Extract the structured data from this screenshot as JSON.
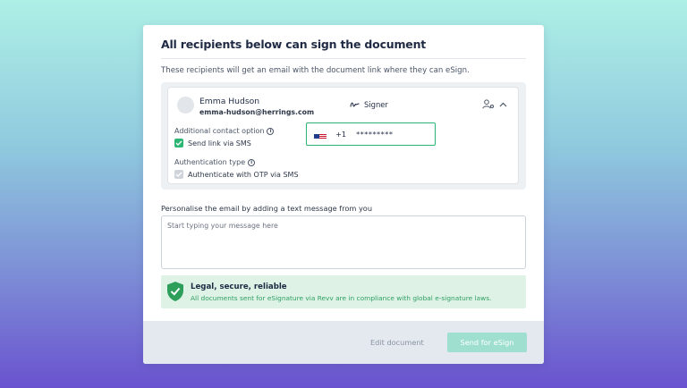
{
  "modal": {
    "title": "All recipients below can sign the document",
    "subtitle": "These recipients will get an email with the document link where they can eSign."
  },
  "recipient": {
    "name": "Emma Hudson",
    "email": "emma-hudson@herrings.com",
    "role": "Signer",
    "contact_label": "Additional contact option",
    "send_sms_label": "Send link via SMS",
    "send_sms_checked": true,
    "auth_label": "Authentication type",
    "otp_label": "Authenticate with OTP via SMS",
    "otp_checked": true,
    "otp_disabled": true,
    "phone": {
      "country_code": "+1",
      "number": "*********",
      "flag_icon": "us-flag-icon"
    }
  },
  "message": {
    "label": "Personalise the email by adding a text message from you",
    "placeholder": "Start typing your message here",
    "value": ""
  },
  "legal": {
    "title": "Legal, secure, reliable",
    "description": "All documents sent for eSignature via Revv are in compliance with global e-signature laws.",
    "icon": "shield-check-icon"
  },
  "footer": {
    "edit_label": "Edit document",
    "send_label": "Send for eSign"
  },
  "colors": {
    "accent_green": "#2bb673",
    "send_button_disabled": "#9fdfd0",
    "legal_bg": "#def3e6",
    "footer_bg": "#e4e8ef"
  }
}
